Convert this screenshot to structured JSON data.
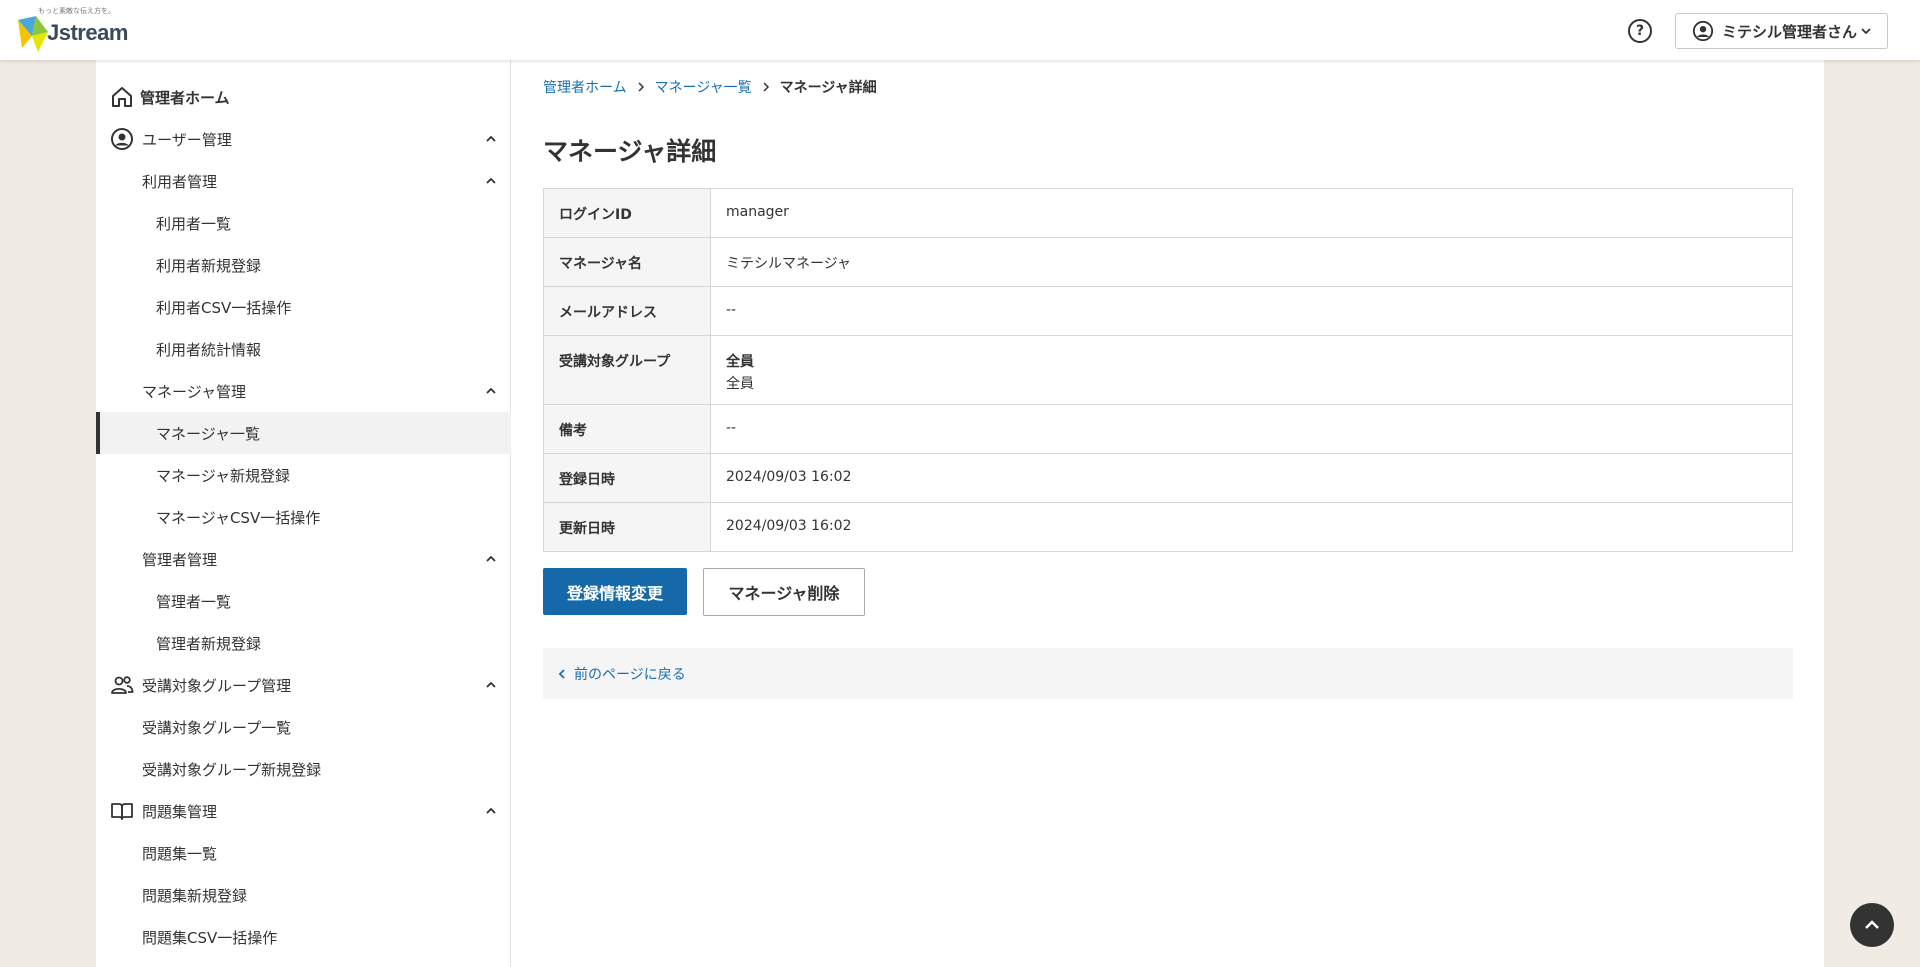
{
  "header": {
    "logo_tagline": "もっと素敵な伝え方を。",
    "logo_text": "Jstream",
    "help_icon": "question-circle-icon",
    "user_name": "ミテシル管理者さん"
  },
  "sidebar": {
    "home": "管理者ホーム",
    "user_mgmt": "ユーザー管理",
    "user_sub": "利用者管理",
    "user_list": "利用者一覧",
    "user_new": "利用者新規登録",
    "user_csv": "利用者CSV一括操作",
    "user_stats": "利用者統計情報",
    "mgr_sub": "マネージャ管理",
    "mgr_list": "マネージャ一覧",
    "mgr_new": "マネージャ新規登録",
    "mgr_csv": "マネージャCSV一括操作",
    "admin_sub": "管理者管理",
    "admin_list": "管理者一覧",
    "admin_new": "管理者新規登録",
    "group_mgmt": "受講対象グループ管理",
    "group_list": "受講対象グループ一覧",
    "group_new": "受講対象グループ新規登録",
    "quiz_mgmt": "問題集管理",
    "quiz_list": "問題集一覧",
    "quiz_new": "問題集新規登録",
    "quiz_csv": "問題集CSV一括操作"
  },
  "breadcrumb": {
    "home": "管理者ホーム",
    "list": "マネージャ一覧",
    "current": "マネージャ詳細"
  },
  "page": {
    "title": "マネージャ詳細"
  },
  "details": {
    "login_id_label": "ログインID",
    "login_id": "manager",
    "name_label": "マネージャ名",
    "name": "ミテシルマネージャ",
    "email_label": "メールアドレス",
    "email": "--",
    "group_label": "受講対象グループ",
    "group_name": "全員",
    "group_sub": "全員",
    "note_label": "備考",
    "note": "--",
    "created_label": "登録日時",
    "created": "2024/09/03 16:02",
    "updated_label": "更新日時",
    "updated": "2024/09/03 16:02"
  },
  "actions": {
    "edit": "登録情報変更",
    "delete": "マネージャ削除",
    "back": "前のページに戻る"
  },
  "colors": {
    "accent": "#1569a8",
    "link": "#1a6fb0",
    "background": "#f1ece3"
  }
}
